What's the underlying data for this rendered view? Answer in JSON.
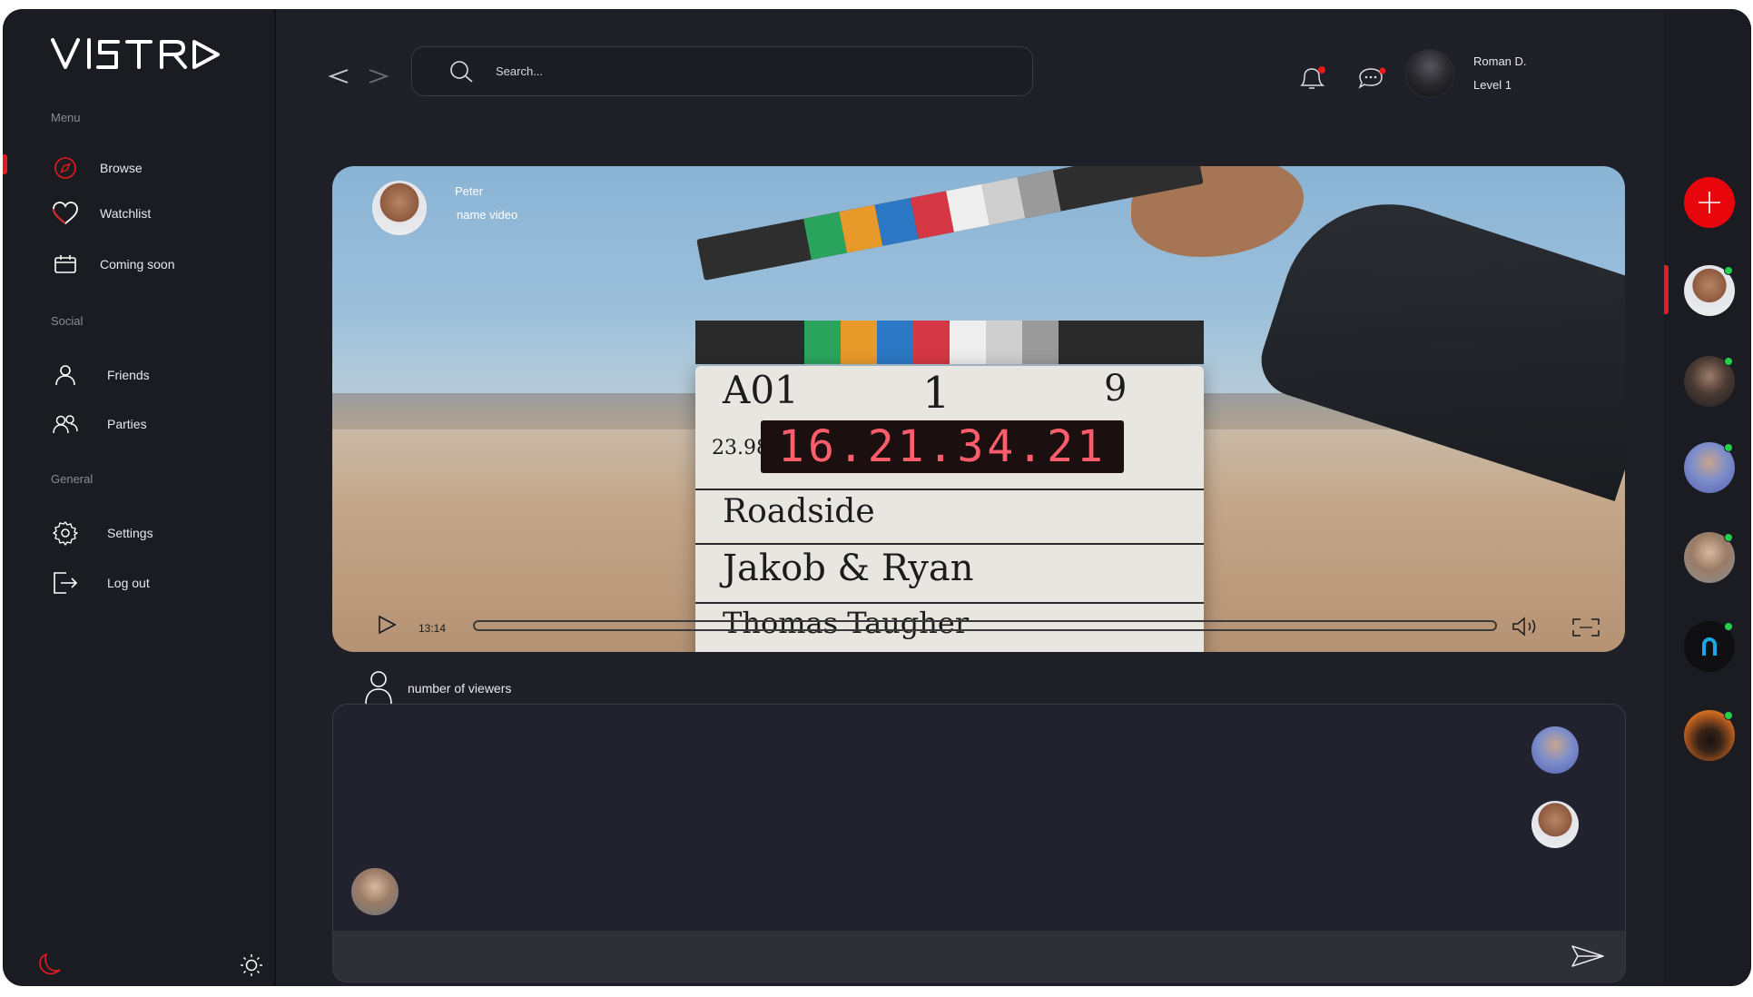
{
  "brand": {
    "name": "VISTRA"
  },
  "sidebar": {
    "sections": [
      {
        "title": "Menu"
      },
      {
        "title": "Social"
      },
      {
        "title": "General"
      }
    ],
    "items": [
      {
        "label": "Browse",
        "icon": "compass-icon"
      },
      {
        "label": "Watchlist",
        "icon": "heart-icon"
      },
      {
        "label": "Coming soon",
        "icon": "calendar-icon"
      },
      {
        "label": "Friends",
        "icon": "user-icon"
      },
      {
        "label": "Parties",
        "icon": "users-icon"
      },
      {
        "label": "Settings",
        "icon": "gear-icon"
      },
      {
        "label": "Log out",
        "icon": "logout-icon"
      }
    ],
    "active_item": "Browse"
  },
  "topbar": {
    "search_placeholder": "Search...",
    "user": {
      "name": "Roman D.",
      "level": "Level 1"
    },
    "notifications_badge_color": "#e61c1c"
  },
  "video": {
    "streamer_name": "Peter",
    "title": "name video",
    "current_time": "13:14",
    "progress": 0.0,
    "clapboard": {
      "roll": "A01",
      "scene": "1",
      "take": "9",
      "fps": "23.98",
      "timecode": "16.21.34.21",
      "prod": "Roadside",
      "dir": "Jakob & Ryan",
      "cam": "Thomas Taugher"
    }
  },
  "viewers": {
    "label": "number of viewers"
  },
  "chat": {
    "input_value": ""
  },
  "colors": {
    "accent": "#e8060c",
    "background": "#1f1f27",
    "sidebar": "#1b1b22",
    "online": "#21d14c"
  }
}
